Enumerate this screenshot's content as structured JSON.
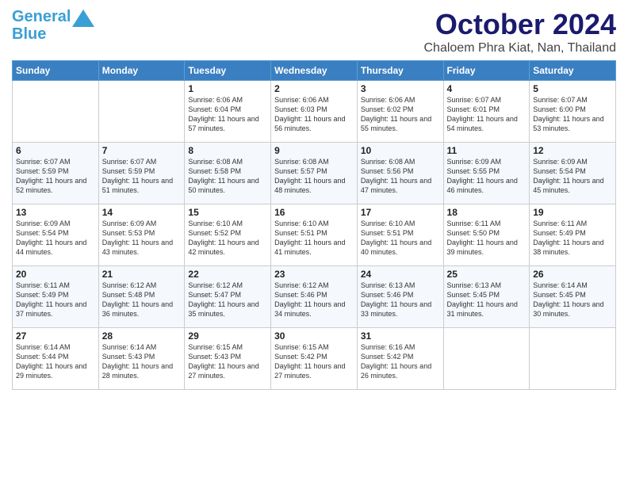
{
  "logo": {
    "line1": "General",
    "line2": "Blue"
  },
  "header": {
    "month": "October 2024",
    "location": "Chaloem Phra Kiat, Nan, Thailand"
  },
  "days_of_week": [
    "Sunday",
    "Monday",
    "Tuesday",
    "Wednesday",
    "Thursday",
    "Friday",
    "Saturday"
  ],
  "weeks": [
    [
      {
        "day": "",
        "sunrise": "",
        "sunset": "",
        "daylight": ""
      },
      {
        "day": "",
        "sunrise": "",
        "sunset": "",
        "daylight": ""
      },
      {
        "day": "1",
        "sunrise": "Sunrise: 6:06 AM",
        "sunset": "Sunset: 6:04 PM",
        "daylight": "Daylight: 11 hours and 57 minutes."
      },
      {
        "day": "2",
        "sunrise": "Sunrise: 6:06 AM",
        "sunset": "Sunset: 6:03 PM",
        "daylight": "Daylight: 11 hours and 56 minutes."
      },
      {
        "day": "3",
        "sunrise": "Sunrise: 6:06 AM",
        "sunset": "Sunset: 6:02 PM",
        "daylight": "Daylight: 11 hours and 55 minutes."
      },
      {
        "day": "4",
        "sunrise": "Sunrise: 6:07 AM",
        "sunset": "Sunset: 6:01 PM",
        "daylight": "Daylight: 11 hours and 54 minutes."
      },
      {
        "day": "5",
        "sunrise": "Sunrise: 6:07 AM",
        "sunset": "Sunset: 6:00 PM",
        "daylight": "Daylight: 11 hours and 53 minutes."
      }
    ],
    [
      {
        "day": "6",
        "sunrise": "Sunrise: 6:07 AM",
        "sunset": "Sunset: 5:59 PM",
        "daylight": "Daylight: 11 hours and 52 minutes."
      },
      {
        "day": "7",
        "sunrise": "Sunrise: 6:07 AM",
        "sunset": "Sunset: 5:59 PM",
        "daylight": "Daylight: 11 hours and 51 minutes."
      },
      {
        "day": "8",
        "sunrise": "Sunrise: 6:08 AM",
        "sunset": "Sunset: 5:58 PM",
        "daylight": "Daylight: 11 hours and 50 minutes."
      },
      {
        "day": "9",
        "sunrise": "Sunrise: 6:08 AM",
        "sunset": "Sunset: 5:57 PM",
        "daylight": "Daylight: 11 hours and 48 minutes."
      },
      {
        "day": "10",
        "sunrise": "Sunrise: 6:08 AM",
        "sunset": "Sunset: 5:56 PM",
        "daylight": "Daylight: 11 hours and 47 minutes."
      },
      {
        "day": "11",
        "sunrise": "Sunrise: 6:09 AM",
        "sunset": "Sunset: 5:55 PM",
        "daylight": "Daylight: 11 hours and 46 minutes."
      },
      {
        "day": "12",
        "sunrise": "Sunrise: 6:09 AM",
        "sunset": "Sunset: 5:54 PM",
        "daylight": "Daylight: 11 hours and 45 minutes."
      }
    ],
    [
      {
        "day": "13",
        "sunrise": "Sunrise: 6:09 AM",
        "sunset": "Sunset: 5:54 PM",
        "daylight": "Daylight: 11 hours and 44 minutes."
      },
      {
        "day": "14",
        "sunrise": "Sunrise: 6:09 AM",
        "sunset": "Sunset: 5:53 PM",
        "daylight": "Daylight: 11 hours and 43 minutes."
      },
      {
        "day": "15",
        "sunrise": "Sunrise: 6:10 AM",
        "sunset": "Sunset: 5:52 PM",
        "daylight": "Daylight: 11 hours and 42 minutes."
      },
      {
        "day": "16",
        "sunrise": "Sunrise: 6:10 AM",
        "sunset": "Sunset: 5:51 PM",
        "daylight": "Daylight: 11 hours and 41 minutes."
      },
      {
        "day": "17",
        "sunrise": "Sunrise: 6:10 AM",
        "sunset": "Sunset: 5:51 PM",
        "daylight": "Daylight: 11 hours and 40 minutes."
      },
      {
        "day": "18",
        "sunrise": "Sunrise: 6:11 AM",
        "sunset": "Sunset: 5:50 PM",
        "daylight": "Daylight: 11 hours and 39 minutes."
      },
      {
        "day": "19",
        "sunrise": "Sunrise: 6:11 AM",
        "sunset": "Sunset: 5:49 PM",
        "daylight": "Daylight: 11 hours and 38 minutes."
      }
    ],
    [
      {
        "day": "20",
        "sunrise": "Sunrise: 6:11 AM",
        "sunset": "Sunset: 5:49 PM",
        "daylight": "Daylight: 11 hours and 37 minutes."
      },
      {
        "day": "21",
        "sunrise": "Sunrise: 6:12 AM",
        "sunset": "Sunset: 5:48 PM",
        "daylight": "Daylight: 11 hours and 36 minutes."
      },
      {
        "day": "22",
        "sunrise": "Sunrise: 6:12 AM",
        "sunset": "Sunset: 5:47 PM",
        "daylight": "Daylight: 11 hours and 35 minutes."
      },
      {
        "day": "23",
        "sunrise": "Sunrise: 6:12 AM",
        "sunset": "Sunset: 5:46 PM",
        "daylight": "Daylight: 11 hours and 34 minutes."
      },
      {
        "day": "24",
        "sunrise": "Sunrise: 6:13 AM",
        "sunset": "Sunset: 5:46 PM",
        "daylight": "Daylight: 11 hours and 33 minutes."
      },
      {
        "day": "25",
        "sunrise": "Sunrise: 6:13 AM",
        "sunset": "Sunset: 5:45 PM",
        "daylight": "Daylight: 11 hours and 31 minutes."
      },
      {
        "day": "26",
        "sunrise": "Sunrise: 6:14 AM",
        "sunset": "Sunset: 5:45 PM",
        "daylight": "Daylight: 11 hours and 30 minutes."
      }
    ],
    [
      {
        "day": "27",
        "sunrise": "Sunrise: 6:14 AM",
        "sunset": "Sunset: 5:44 PM",
        "daylight": "Daylight: 11 hours and 29 minutes."
      },
      {
        "day": "28",
        "sunrise": "Sunrise: 6:14 AM",
        "sunset": "Sunset: 5:43 PM",
        "daylight": "Daylight: 11 hours and 28 minutes."
      },
      {
        "day": "29",
        "sunrise": "Sunrise: 6:15 AM",
        "sunset": "Sunset: 5:43 PM",
        "daylight": "Daylight: 11 hours and 27 minutes."
      },
      {
        "day": "30",
        "sunrise": "Sunrise: 6:15 AM",
        "sunset": "Sunset: 5:42 PM",
        "daylight": "Daylight: 11 hours and 27 minutes."
      },
      {
        "day": "31",
        "sunrise": "Sunrise: 6:16 AM",
        "sunset": "Sunset: 5:42 PM",
        "daylight": "Daylight: 11 hours and 26 minutes."
      },
      {
        "day": "",
        "sunrise": "",
        "sunset": "",
        "daylight": ""
      },
      {
        "day": "",
        "sunrise": "",
        "sunset": "",
        "daylight": ""
      }
    ]
  ]
}
